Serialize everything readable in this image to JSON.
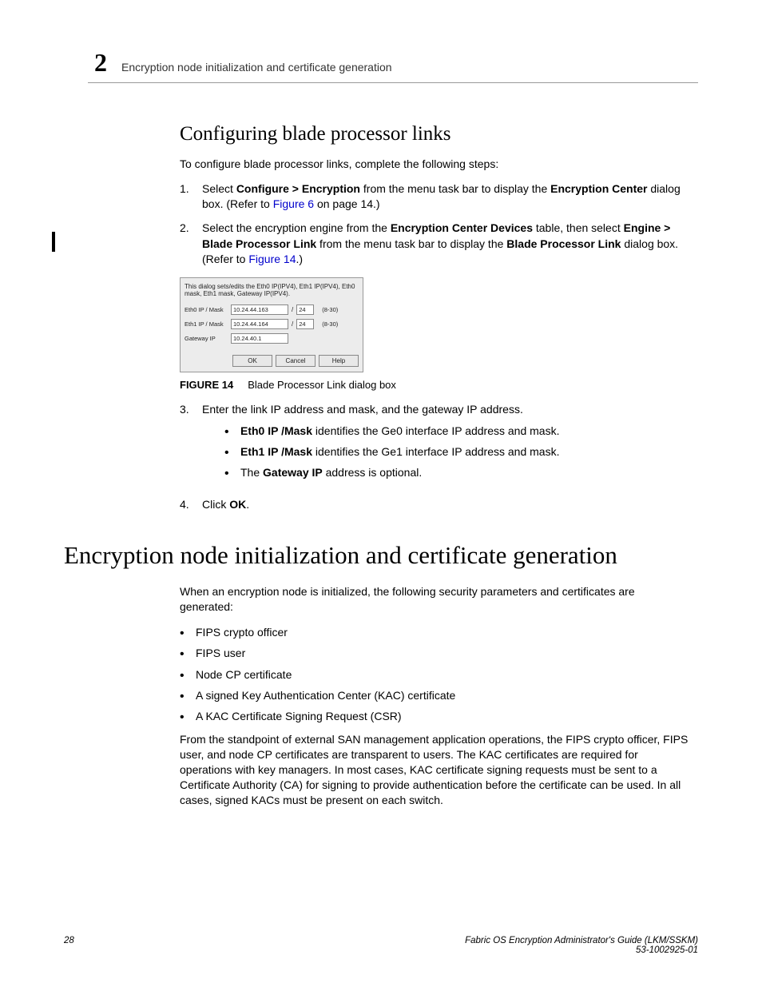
{
  "header": {
    "chapter_number": "2",
    "running_title": "Encryption node initialization and certificate generation"
  },
  "section1": {
    "title": "Configuring blade processor links",
    "intro": "To configure blade processor links, complete the following steps:",
    "step1_pre": "Select ",
    "step1_bold1": "Configure > Encryption",
    "step1_mid": " from the menu task bar to display the ",
    "step1_bold2": "Encryption Center",
    "step1_post": " dialog box. (Refer to ",
    "step1_link": "Figure 6",
    "step1_end": " on page 14.)",
    "step2_pre": "Select the encryption engine from the ",
    "step2_bold1": "Encryption Center Devices",
    "step2_mid1": " table, then select ",
    "step2_bold2": "Engine > Blade Processor Link",
    "step2_mid2": " from the menu task bar to display the ",
    "step2_bold3": "Blade Processor Link",
    "step2_post": " dialog box. (Refer to ",
    "step2_link": "Figure 14",
    "step2_end": ".)",
    "step3": "Enter the link IP address and mask, and the gateway IP address.",
    "step3_b1a": "Eth0 IP /Mask",
    "step3_b1b": " identifies the Ge0 interface IP address and mask.",
    "step3_b2a": "Eth1 IP /Mask",
    "step3_b2b": " identifies the Ge1 interface IP address and mask.",
    "step3_b3a": "The ",
    "step3_b3b": "Gateway IP",
    "step3_b3c": " address is optional.",
    "step4_pre": "Click ",
    "step4_bold": "OK",
    "step4_post": "."
  },
  "figure": {
    "label": "FIGURE 14",
    "caption": "Blade Processor Link dialog box",
    "dialog": {
      "desc": "This dialog sets/edits the Eth0 IP(IPV4), Eth1 IP(IPV4), Eth0 mask, Eth1 mask, Gateway IP(IPV4).",
      "eth0_label": "Eth0 IP / Mask",
      "eth0_ip": "10.24.44.163",
      "eth0_mask": "24",
      "eth1_label": "Eth1 IP / Mask",
      "eth1_ip": "10.24.44.164",
      "eth1_mask": "24",
      "gw_label": "Gateway IP",
      "gw_ip": "10.24.40.1",
      "range": "(8-30)",
      "slash": "/",
      "btn_ok": "OK",
      "btn_cancel": "Cancel",
      "btn_help": "Help"
    }
  },
  "section2": {
    "title": "Encryption node initialization and certificate generation",
    "intro": "When an encryption node is initialized, the following security parameters and certificates are generated:",
    "bullets": [
      "FIPS crypto officer",
      "FIPS user",
      "Node CP certificate",
      "A signed Key Authentication Center (KAC) certificate",
      "A KAC Certificate Signing Request (CSR)"
    ],
    "para2": "From the standpoint of external SAN management application operations, the FIPS crypto officer, FIPS user, and node CP certificates are transparent to users. The KAC certificates are required for operations with key managers. In most cases, KAC certificate signing requests must be sent to a Certificate Authority (CA) for signing to provide authentication before the certificate can be used. In all cases, signed KACs must be present on each switch."
  },
  "footer": {
    "page_num": "28",
    "book_title": "Fabric OS Encryption Administrator's Guide  (LKM/SSKM)",
    "doc_num": "53-1002925-01"
  }
}
